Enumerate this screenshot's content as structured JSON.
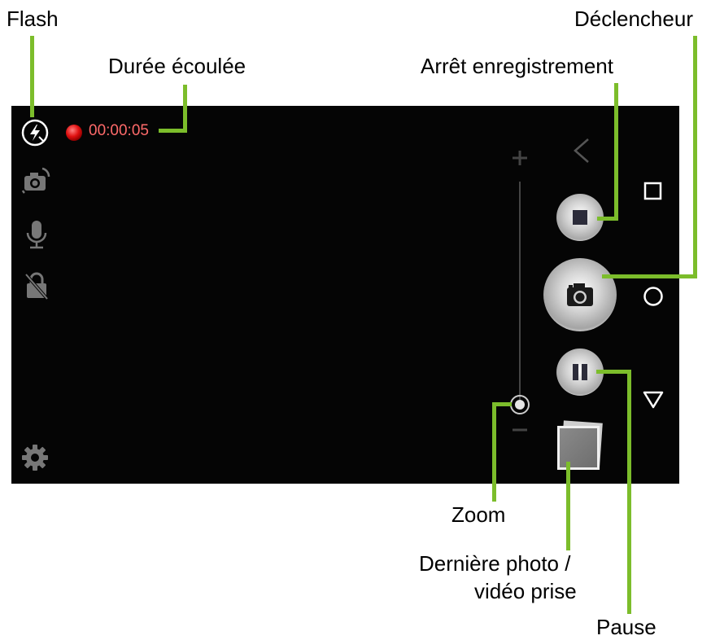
{
  "callouts": {
    "flash": "Flash",
    "elapsed": "Durée écoulée",
    "stop_recording": "Arrêt enregistrement",
    "shutter": "Déclencheur",
    "zoom": "Zoom",
    "last_media_line1": "Dernière photo /",
    "last_media_line2": "vidéo prise",
    "pause": "Pause"
  },
  "screen": {
    "timer": "00:00:05",
    "zoom_plus": "+",
    "zoom_minus": "−"
  },
  "colors": {
    "leader": "#7cbd2b",
    "screen_bg": "#050505",
    "record_dot": "#e01010",
    "timer_text": "#ff6a6a"
  },
  "icons": [
    "flash-off-icon",
    "switch-camera-icon",
    "microphone-icon",
    "lock-off-icon",
    "gear-icon",
    "back-icon",
    "recents-icon",
    "home-icon",
    "nav-down-icon",
    "camera-icon",
    "stop-icon",
    "pause-icon"
  ]
}
